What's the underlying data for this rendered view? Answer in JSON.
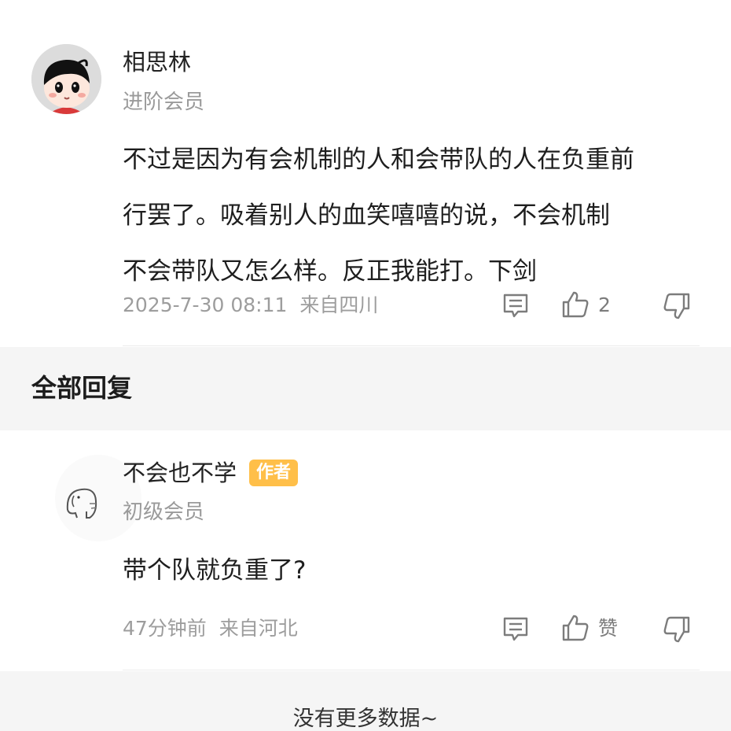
{
  "main_comment": {
    "author": "相思林",
    "level": "进阶会员",
    "content_lines": [
      "不过是因为有会机制的人和会带队的人在负重前",
      "行罢了。吸着别人的血笑嘻嘻的说，不会机制",
      "不会带队又怎么样。反正我能打。下剑"
    ],
    "time": "2025-7-30 08:11",
    "location": "来自四川",
    "likes": "2",
    "icons": {
      "reply": "comment-icon",
      "like": "thumbs-up-icon",
      "dislike": "thumbs-down-icon"
    }
  },
  "replies_section": {
    "title": "全部回复"
  },
  "reply": {
    "author": "不会也不学",
    "badge": "作者",
    "level": "初级会员",
    "content": "带个队就负重了?",
    "time": "47分钟前",
    "location": "来自河北",
    "like_label": "赞"
  },
  "footer": {
    "text": "没有更多数据~"
  },
  "colors": {
    "badge": "#ffbf49",
    "band": "#f5f5f5",
    "meta": "#9d9d9d"
  }
}
